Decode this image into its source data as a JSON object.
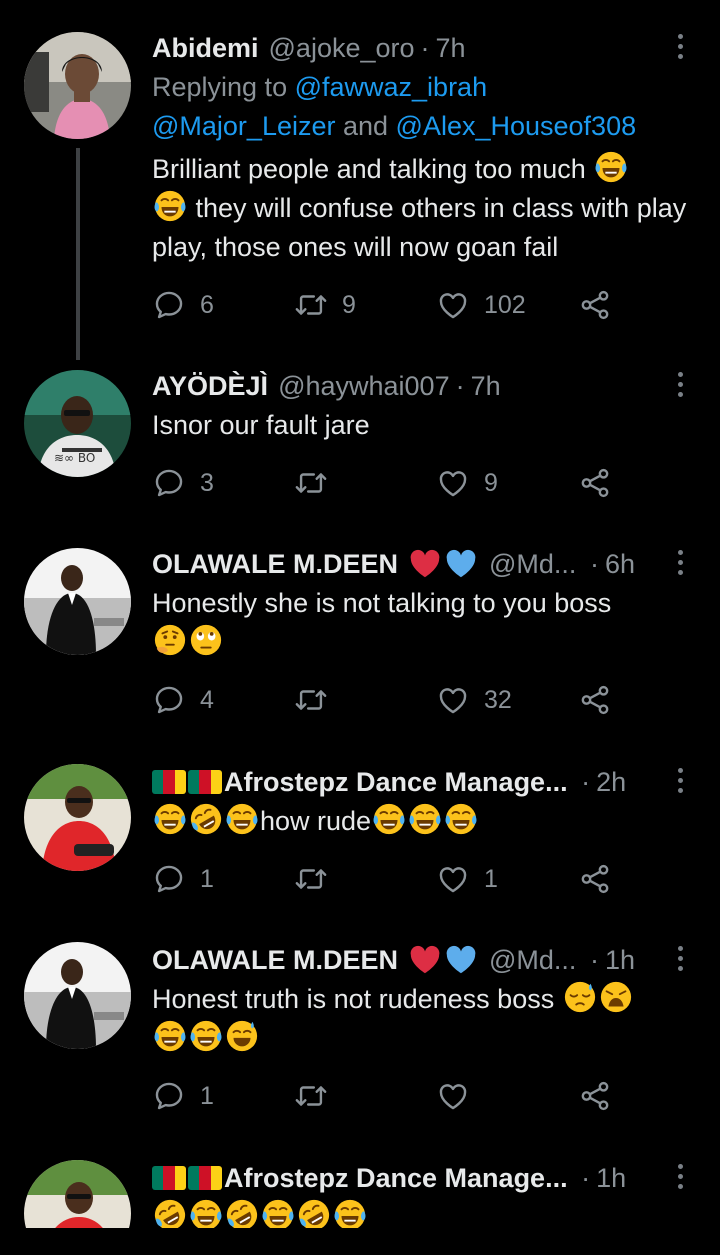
{
  "tweets": [
    {
      "name": "Abidemi",
      "handle": "@ajoke_oro",
      "time": "7h",
      "reply_prefix": "Replying to ",
      "reply_mention_1": "@fawwaz_ibrah",
      "reply_mention_2": "@Major_Leizer",
      "reply_and": " and ",
      "reply_mention_3": "@Alex_Houseof308",
      "text_1": "Brilliant people and talking too much ",
      "text_2": " they will confuse others in class with play play, those ones will now goan fail",
      "replies": "6",
      "retweets": "9",
      "likes": "102"
    },
    {
      "name": "AYÖDÈJÌ",
      "handle": "@haywhai007",
      "time": "7h",
      "text": "Isnor our fault jare",
      "replies": "3",
      "retweets": "",
      "likes": "9"
    },
    {
      "name": "OLAWALE M.DEEN",
      "handle": "@Md...",
      "time": "6h",
      "text": "Honestly she is not talking to you boss",
      "replies": "4",
      "retweets": "",
      "likes": "32"
    },
    {
      "name": "Afrostepz Dance Manage...",
      "time": "2h",
      "text_1": "how rude",
      "replies": "1",
      "retweets": "",
      "likes": "1"
    },
    {
      "name": "OLAWALE M.DEEN",
      "handle": "@Md...",
      "time": "1h",
      "text": "Honest truth is not rudeness boss ",
      "replies": "1",
      "retweets": "",
      "likes": ""
    },
    {
      "name": "Afrostepz Dance Manage...",
      "time": "1h"
    }
  ],
  "colors": {
    "background": "#000000",
    "text": "#e7e9ea",
    "secondary": "#8b9298",
    "link": "#1d9bf0",
    "thread_line": "#3e4144"
  },
  "icons": [
    "reply-icon",
    "retweet-icon",
    "like-icon",
    "share-icon",
    "more-options-icon",
    "laughing-tears-emoji",
    "rofl-emoji",
    "thinking-emoji",
    "eye-roll-emoji",
    "pensive-sweat-emoji",
    "weary-emoji",
    "sweat-smile-emoji",
    "red-heart-emoji",
    "blue-heart-emoji",
    "cameroon-flag"
  ]
}
